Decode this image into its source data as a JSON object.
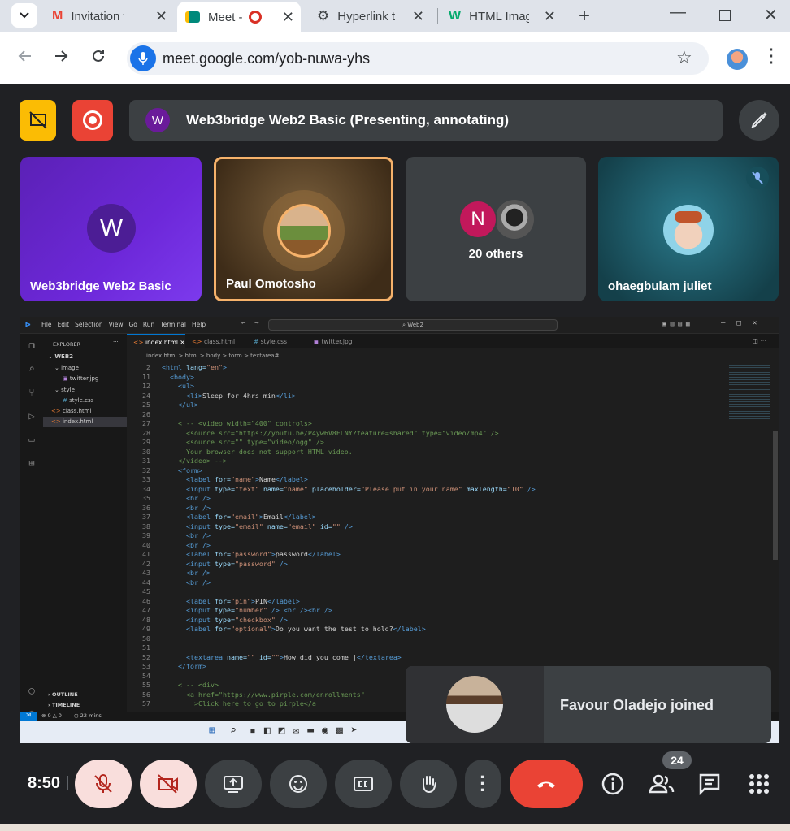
{
  "browser": {
    "tabs": [
      {
        "title": "Invitation fr",
        "icon": "gmail-icon"
      },
      {
        "title": "Meet -",
        "icon": "meet-icon"
      },
      {
        "title": "Hyperlink t",
        "icon": "openai-icon"
      },
      {
        "title": "HTML Imag",
        "icon": "w3schools-icon"
      }
    ],
    "url": "meet.google.com/yob-nuwa-yhs"
  },
  "meeting": {
    "presenter_initial": "W",
    "presentation_title": "Web3bridge Web2 Basic (Presenting, annotating)",
    "tiles": [
      {
        "name": "Web3bridge Web2 Basic",
        "initial": "W"
      },
      {
        "name": "Paul Omotosho"
      },
      {
        "name": "20 others",
        "initial": "N"
      },
      {
        "name": "ohaegbulam juliet"
      }
    ],
    "notification": "Favour Oladejo joined",
    "time": "8:50",
    "participants_count": "24"
  },
  "vscode": {
    "menu": [
      "File",
      "Edit",
      "Selection",
      "View",
      "Go",
      "Run",
      "Terminal",
      "Help"
    ],
    "search": "Web2",
    "tabs": [
      "index.html",
      "class.html",
      "style.css",
      "twitter.jpg"
    ],
    "explorer_title": "EXPLORER",
    "tree": [
      "WEB2",
      "image",
      "twitter.jpg",
      "style",
      "style.css",
      "class.html",
      "index.html"
    ],
    "outline": "OUTLINE",
    "timeline": "TIMELINE",
    "breadcrumb": "index.html > html > body > form > textarea#",
    "status_errors": "0",
    "status_warnings": "0",
    "status_time": "22 mins"
  },
  "colors": {
    "accent_blue": "#8ab4f8",
    "end_call_red": "#ea4335",
    "tile_purple": "#5b21b6",
    "active_speaker_border": "#f6b26b"
  }
}
